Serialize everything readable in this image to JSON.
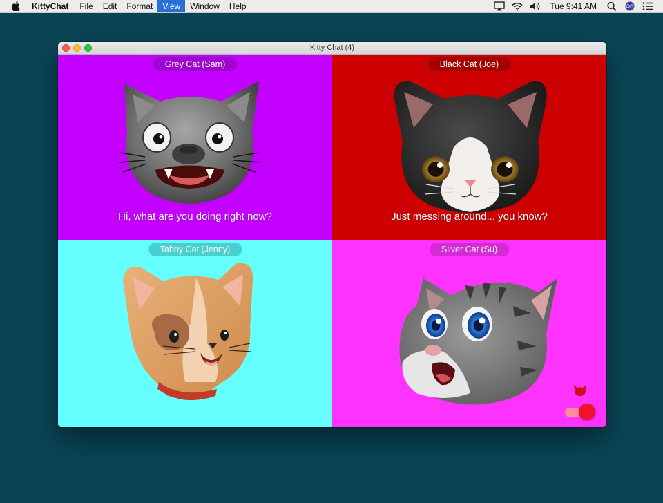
{
  "menubar": {
    "app_name": "KittyChat",
    "items": [
      "File",
      "Edit",
      "Format",
      "View",
      "Window",
      "Help"
    ],
    "active_item": "View",
    "clock": "Tue 9:41 AM"
  },
  "window": {
    "title": "Kitty Chat (4)"
  },
  "tiles": [
    {
      "name": "Grey Cat (Sam)",
      "caption": "Hi, what are you doing right now?",
      "bg": "#c300ff",
      "pill_bg": "#9e05cf"
    },
    {
      "name": "Black Cat (Joe)",
      "caption": "Just messing around... you know?",
      "bg": "#cc0000",
      "pill_bg": "#a40000"
    },
    {
      "name": "Tabby Cat (Jenny)",
      "caption": "",
      "bg": "#66ffff",
      "pill_bg": "#48cfcf"
    },
    {
      "name": "Silver Cat (Su)",
      "caption": "",
      "bg": "#ff33ff",
      "pill_bg": "#d52ad6"
    }
  ],
  "controls": {
    "toggle_on": true,
    "accent": "#f0112b"
  }
}
